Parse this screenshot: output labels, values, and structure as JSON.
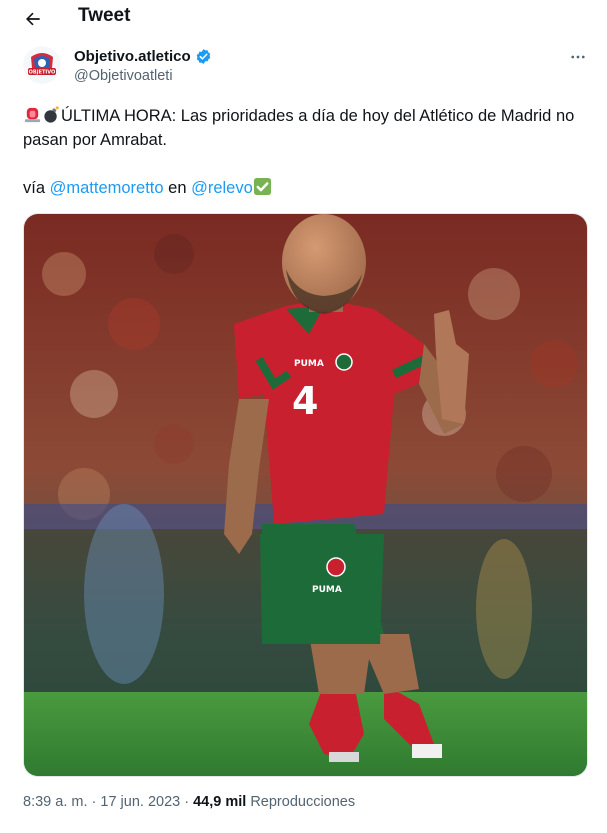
{
  "header": {
    "title": "Tweet"
  },
  "author": {
    "display_name": "Objetivo.atletico",
    "handle": "@Objetivoatleti",
    "avatar_text": "OBJETIVO"
  },
  "tweet": {
    "breaking_text": "ÚLTIMA HORA: Las prioridades a día de hoy del Atlético de Madrid no pasan por Amrabat.",
    "via_prefix": "vía ",
    "mention_1": "@mattemoretto",
    "connector": " en ",
    "mention_2": "@relevo",
    "emoji_names": [
      "police-light-emoji",
      "bomb-emoji",
      "check-mark-emoji"
    ]
  },
  "media": {
    "jersey_number": "4",
    "jersey_brand": "PUMA",
    "shorts_brand": "PUMA"
  },
  "meta": {
    "time": "8:39 a. m.",
    "separator": " · ",
    "date": "17 jun. 2023",
    "views_count": "44,9 mil",
    "views_label": " Reproducciones"
  },
  "colors": {
    "text": "#0f1419",
    "secondary": "#536471",
    "link": "#1d9bf0",
    "verified": "#1d9bf0",
    "pitch": "#3f8f3a",
    "jersey": "#c8202f",
    "shorts": "#1e6b3a"
  }
}
